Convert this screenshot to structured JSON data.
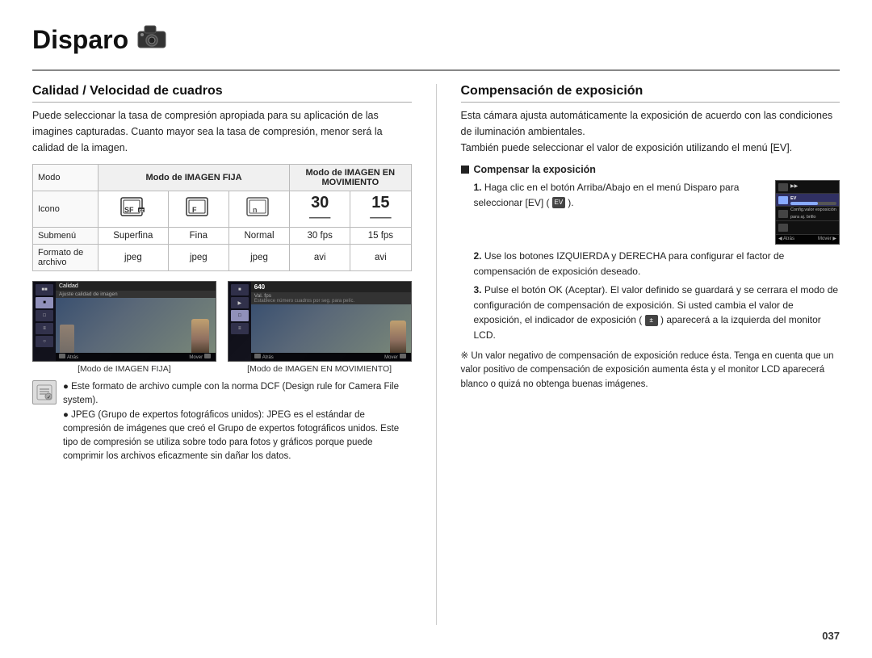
{
  "title": "Disparo",
  "title_rule": true,
  "left_section": {
    "title": "Calidad / Velocidad de cuadros",
    "description": "Puede seleccionar la tasa de compresión apropiada para su aplicación de las imagines capturadas. Cuanto mayor sea la tasa de compresión, menor será la calidad de la imagen.",
    "table": {
      "headers": [
        "Modo",
        "Modo de IMAGEN FIJA",
        "",
        "",
        "Modo de IMAGEN EN MOVIMIENTO",
        ""
      ],
      "rows": [
        {
          "label": "Modo",
          "cells": [
            "Modo de IMAGEN FIJA",
            "",
            "",
            "Modo de IMAGEN EN MOVIMIENTO",
            ""
          ]
        },
        {
          "label": "Icono",
          "cells": [
            "SF_icon",
            "F_icon",
            "N_icon",
            "30fps_icon",
            "15fps_icon"
          ]
        },
        {
          "label": "Submenú",
          "cells": [
            "Superfina",
            "Fina",
            "Normal",
            "30 fps",
            "15 fps"
          ]
        },
        {
          "label_line1": "Formato de",
          "label_line2": "archivo",
          "cells": [
            "jpeg",
            "jpeg",
            "jpeg",
            "avi",
            "avi"
          ]
        }
      ]
    },
    "screenshots": [
      {
        "caption": "[Modo de IMAGEN FIJA]",
        "label": "Calidad",
        "sublabel": "Ajuste calidad de imagen",
        "bottom_left": "Atrás",
        "bottom_right": "Mover"
      },
      {
        "caption": "[Modo de IMAGEN EN MOVIMIENTO]",
        "label": "640",
        "sublabel": "Val. fps",
        "sublabel2": "Establece número cuadros por seg. para pelíc.",
        "bottom_left": "Atrás",
        "bottom_right": "Mover"
      }
    ],
    "note_lines": [
      "Este formato de archivo cumple con la norma DCF (Design rule for Camera File system).",
      "JPEG (Grupo de expertos fotográficos unidos): JPEG es el estándar de compresión de imágenes que creó el Grupo de expertos fotográficos unidos. Este tipo de compresión se utiliza sobre todo para fotos y gráficos porque puede comprimir los archivos eficazmente sin dañar los datos."
    ]
  },
  "right_section": {
    "title": "Compensación de exposición",
    "description_lines": [
      "Esta cámara ajusta automáticamente la exposición de acuerdo con las condiciones de iluminación ambientales.",
      "También puede seleccionar el valor de exposición utilizando el menú [EV]."
    ],
    "compensar_label": "Compensar la exposición",
    "steps": [
      {
        "number": "1.",
        "text": "Haga clic en el botón Arriba/Abajo en el menú Disparo para seleccionar [EV] (",
        "text_cont": ").",
        "has_image": true
      },
      {
        "number": "2.",
        "text": "Use los botones IZQUIERDA y DERECHA para configurar el factor de compensación de exposición deseado."
      },
      {
        "number": "3.",
        "text": "Pulse el botón OK (Aceptar). El valor definido se guardará y se cerrara el modo de configuración de compensación de exposición. Si usted cambia el valor de exposición, el indicador de exposición (",
        "text_mid": ")",
        "text_end": " aparecerá a la izquierda del monitor LCD."
      }
    ],
    "note_asterisk": "※ Un valor negativo de compensación de exposición reduce ésta. Tenga en cuenta que un valor positivo de compensación de exposición aumenta ésta y el monitor LCD aparecerá blanco o quizá no obtenga buenas imágenes."
  },
  "page_number": "037"
}
